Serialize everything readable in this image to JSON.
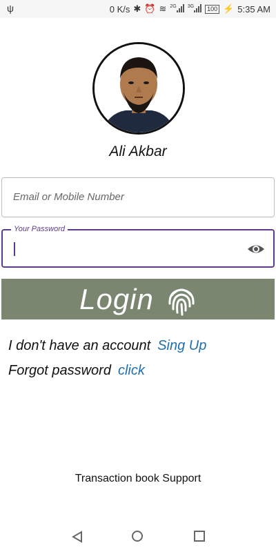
{
  "status_bar": {
    "speed": "0 K/s",
    "signal1_label": "2G",
    "signal2_label": "3G",
    "battery": "100",
    "time": "5:35 AM",
    "icons": [
      "usb-icon",
      "bluetooth-icon",
      "alarm-icon",
      "wifi-icon",
      "signal-icon",
      "battery-icon"
    ]
  },
  "profile": {
    "name": "Ali Akbar"
  },
  "email_field": {
    "placeholder": "Email or Mobile Number",
    "value": ""
  },
  "password_field": {
    "label": "Your Password",
    "value": ""
  },
  "login_button": {
    "label": "Login"
  },
  "links": {
    "no_account_text": "I don't have an account",
    "signup_label": "Sing Up",
    "forgot_text": "Forgot password",
    "click_label": "click"
  },
  "footer": {
    "support_text": "Transaction book Support"
  },
  "colors": {
    "accent": "#5b3a8e",
    "button_bg": "#7a8670",
    "link": "#1e6fb0"
  }
}
